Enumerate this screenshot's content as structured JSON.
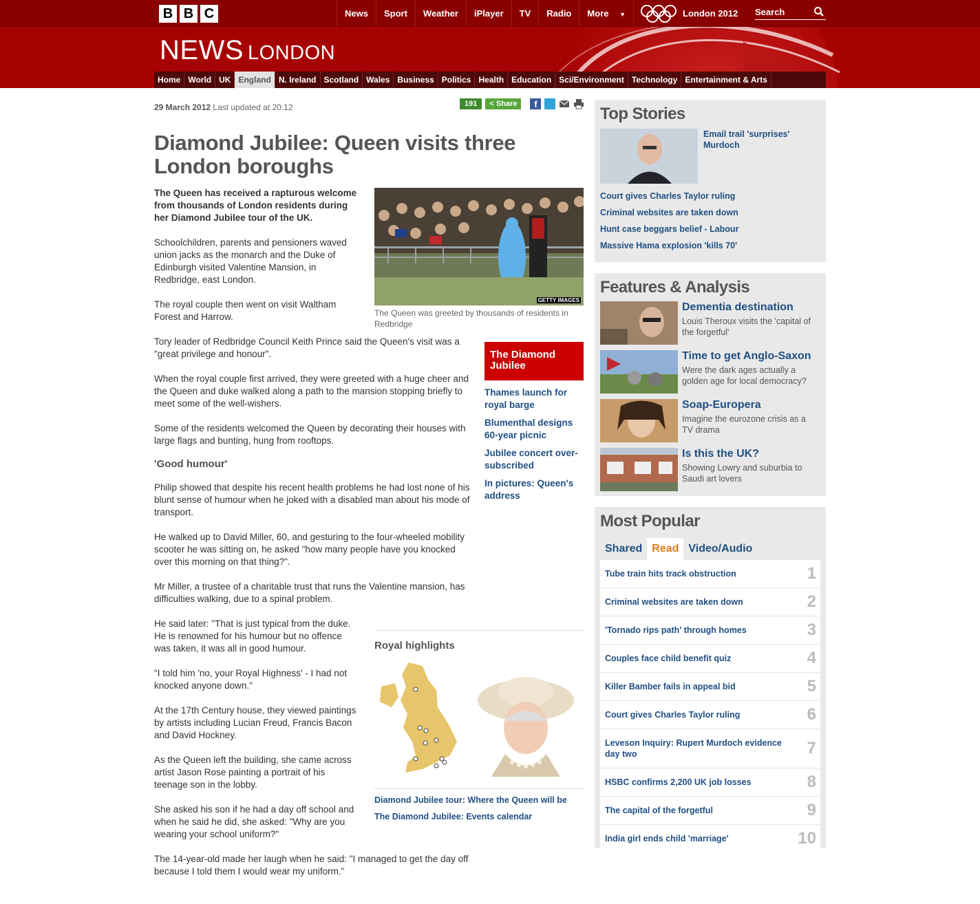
{
  "header": {
    "logo_letters": [
      "B",
      "B",
      "C"
    ],
    "nav": [
      "News",
      "Sport",
      "Weather",
      "iPlayer",
      "TV",
      "Radio",
      "More"
    ],
    "olympics_label": "London 2012",
    "search_placeholder": "Search",
    "brand_big": "NEWS",
    "brand_small": "LONDON",
    "sections": [
      "Home",
      "World",
      "UK",
      "England",
      "N. Ireland",
      "Scotland",
      "Wales",
      "Business",
      "Politics",
      "Health",
      "Education",
      "Sci/Environment",
      "Technology",
      "Entertainment & Arts"
    ],
    "active_section": "England",
    "accent": "#a70202"
  },
  "article": {
    "date": "29 March 2012",
    "updated": "Last updated at 20:12",
    "share_count": "191",
    "share_label": "Share",
    "headline": "Diamond Jubilee: Queen visits three London boroughs",
    "intro": "The Queen has received a rapturous welcome from thousands of London residents during her Diamond Jubilee tour of the UK.",
    "paragraphs": [
      "Schoolchildren, parents and pensioners waved union jacks as the monarch and the Duke of Edinburgh visited Valentine Mansion, in Redbridge, east London.",
      "The royal couple then went on visit Waltham Forest and Harrow.",
      "Tory leader of Redbridge Council Keith Prince said the Queen's visit was a \"great privilege and honour\".",
      "When the royal couple first arrived, they were greeted with a huge cheer and the Queen and duke walked along a path to the mansion stopping briefly to meet some of the well-wishers.",
      "Some of the residents welcomed the Queen by decorating their houses with large flags and bunting, hung from rooftops."
    ],
    "subheading": "'Good humour'",
    "paragraphs2": [
      "Philip showed that despite his recent health problems he had lost none of his blunt sense of humour when he joked with a disabled man about his mode of transport.",
      "He walked up to David Miller, 60, and gesturing to the four-wheeled mobility scooter he was sitting on, he asked \"how many people have you knocked over this morning on that thing?\".",
      "Mr Miller, a trustee of a charitable trust that runs the Valentine mansion, has difficulties walking, due to a spinal problem.",
      "He said later: \"That is just typical from the duke. He is renowned for his humour but no offence was taken, it was all in good humour.",
      "\"I told him 'no, your Royal Highness' - I had not knocked anyone down.\"",
      "At the 17th Century house, they viewed paintings by artists including Lucian Freud, Francis Bacon and David Hockney.",
      "As the Queen left the building, she came across artist Jason Rose painting a portrait of his teenage son in the lobby.",
      "She asked his son if he had a day off school and when he said he did, she asked: \"Why are you wearing your school uniform?\"",
      "The 14-year-old made her laugh when he said: \"I managed to get the day off because I told them I would wear my uniform.\""
    ],
    "image_credit": "GETTY IMAGES",
    "caption": "The Queen was greeted by thousands of residents in Redbridge",
    "related_title": "The Diamond Jubilee",
    "related_links": [
      "Thames launch for royal barge",
      "Blumenthal designs 60-year picnic",
      "Jubilee concert over-subscribed",
      "In pictures: Queen's address"
    ],
    "royal_title": "Royal highlights",
    "royal_links": [
      "Diamond Jubilee tour: Where the Queen will be",
      "The Diamond Jubilee: Events calendar"
    ]
  },
  "sidebar": {
    "top_stories_title": "Top Stories",
    "lead_story": "Email trail 'surprises' Murdoch",
    "stories": [
      "Court gives Charles Taylor ruling",
      "Criminal websites are taken down",
      "Hunt case beggars belief - Labour",
      "Massive Hama explosion 'kills 70'"
    ],
    "features_title": "Features & Analysis",
    "features": [
      {
        "title": "Dementia destination",
        "desc": "Louis Theroux visits the 'capital of the forgetful'"
      },
      {
        "title": "Time to get Anglo-Saxon",
        "desc": "Were the dark ages actually a golden age for local democracy?"
      },
      {
        "title": "Soap-Europera",
        "desc": "Imagine the eurozone crisis as a TV drama"
      },
      {
        "title": "Is this the UK?",
        "desc": "Showing Lowry and suburbia to Saudi art lovers"
      }
    ],
    "popular_title": "Most Popular",
    "tabs": [
      "Shared",
      "Read",
      "Video/Audio"
    ],
    "active_tab": "Read",
    "popular": [
      {
        "title": "Tube train hits track obstruction",
        "rank": "1"
      },
      {
        "title": "Criminal websites are taken down",
        "rank": "2"
      },
      {
        "title": "'Tornado rips path' through homes",
        "rank": "3"
      },
      {
        "title": "Couples face child benefit quiz",
        "rank": "4"
      },
      {
        "title": "Killer Bamber fails in appeal bid",
        "rank": "5"
      },
      {
        "title": "Court gives Charles Taylor ruling",
        "rank": "6"
      },
      {
        "title": "Leveson Inquiry: Rupert Murdoch evidence day two",
        "rank": "7"
      },
      {
        "title": "HSBC confirms 2,200 UK job losses",
        "rank": "8"
      },
      {
        "title": "The capital of the forgetful",
        "rank": "9"
      },
      {
        "title": "India girl ends child 'marriage'",
        "rank": "10"
      }
    ]
  }
}
